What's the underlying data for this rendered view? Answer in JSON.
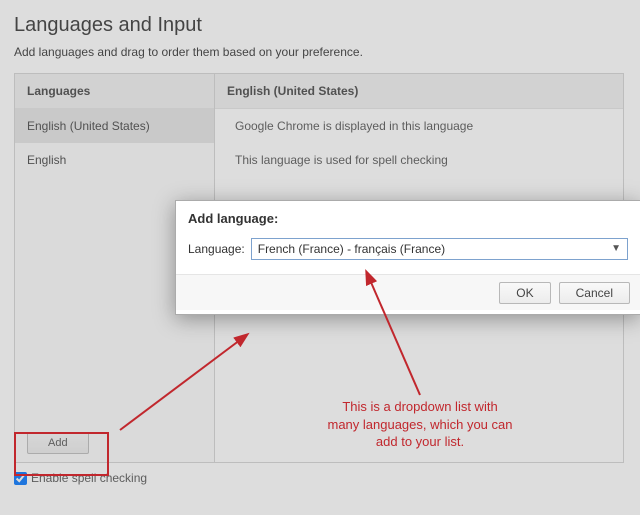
{
  "page": {
    "title": "Languages and Input",
    "subtitle": "Add languages and drag to order them based on your preference."
  },
  "left": {
    "header": "Languages",
    "items": [
      {
        "label": "English (United States)"
      },
      {
        "label": "English"
      }
    ],
    "add_label": "Add"
  },
  "right": {
    "header": "English (United States)",
    "lines": [
      "Google Chrome is displayed in this language",
      "This language is used for spell checking"
    ]
  },
  "spellcheck": {
    "label": "Enable spell checking",
    "checked": true
  },
  "dialog": {
    "title": "Add language:",
    "label": "Language:",
    "selected": "French (France) - français (France)",
    "ok": "OK",
    "cancel": "Cancel"
  },
  "annotation": {
    "text_line1": "This is a dropdown list with",
    "text_line2": "many languages, which you can",
    "text_line3": "add to your list."
  },
  "colors": {
    "highlight": "#c1272d",
    "select_border": "#7da2ce"
  }
}
